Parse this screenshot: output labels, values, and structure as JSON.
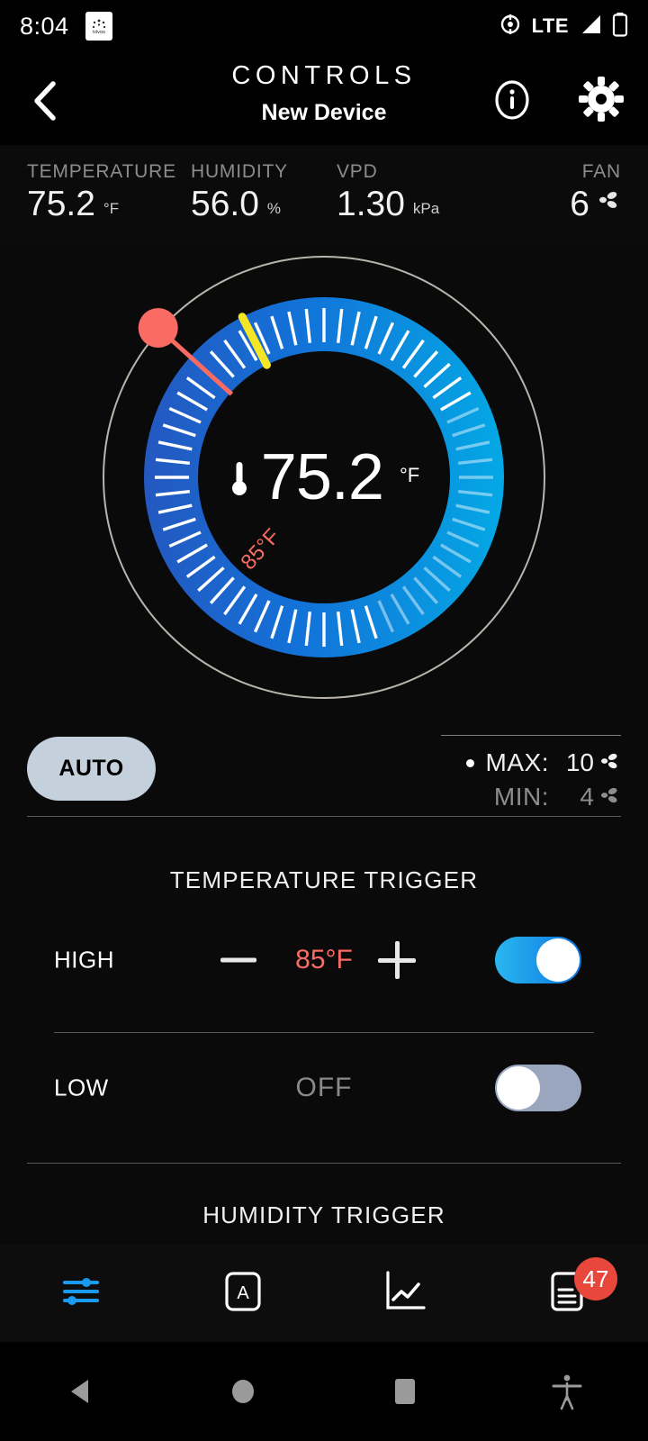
{
  "status_bar": {
    "time": "8:04",
    "app_icon": "app-icon",
    "network": "LTE",
    "icons": [
      "location-icon",
      "signal-icon",
      "battery-icon"
    ]
  },
  "header": {
    "title": "CONTROLS",
    "subtitle": "New Device",
    "back_icon": "chevron-left-icon",
    "info_icon": "info-icon",
    "settings_icon": "gear-icon"
  },
  "stats": [
    {
      "label": "TEMPERATURE",
      "value": "75.2",
      "unit": "°F"
    },
    {
      "label": "HUMIDITY",
      "value": "56.0",
      "unit": "%"
    },
    {
      "label": "VPD",
      "value": "1.30",
      "unit": "kPa"
    },
    {
      "label": "FAN",
      "value": "6",
      "unit": "fan-icon"
    }
  ],
  "gauge": {
    "center_value": "75.2",
    "center_unit": "°F",
    "center_icon": "thermometer-icon",
    "handle_label": "85°F",
    "handle_color": "#fa6b64",
    "needle_color": "#f5e625",
    "ring_start_color": "#2a4fb8",
    "ring_end_color": "#00b7e8",
    "handle_angle_deg": 222,
    "needle_angle_deg": 243,
    "tick_count": 60
  },
  "fan_control": {
    "mode_label": "AUTO",
    "max_label": "MAX:",
    "max_value": "10",
    "min_label": "MIN:",
    "min_value": "4",
    "fan_icon": "fan-icon"
  },
  "temperature_trigger": {
    "title": "TEMPERATURE TRIGGER",
    "rows": [
      {
        "label": "HIGH",
        "value": "85°F",
        "value_color": "#fa6b64",
        "minus_icon": "minus-icon",
        "plus_icon": "plus-icon",
        "toggle_state": "on"
      },
      {
        "label": "LOW",
        "value": "OFF",
        "value_color": "#8a8a8a",
        "toggle_state": "off"
      }
    ]
  },
  "humidity_trigger": {
    "title": "HUMIDITY TRIGGER"
  },
  "tabbar": {
    "items": [
      {
        "icon": "sliders-icon",
        "active": true
      },
      {
        "icon": "auto-box-icon",
        "active": false
      },
      {
        "icon": "line-chart-icon",
        "active": false
      },
      {
        "icon": "document-icon",
        "active": false,
        "badge": "47"
      }
    ],
    "active_color": "#1a9af0",
    "badge_color": "#e8473c"
  },
  "navbar": {
    "back_icon": "android-back-icon",
    "home_icon": "android-home-icon",
    "recents_icon": "android-recents-icon",
    "accessibility_icon": "accessibility-icon"
  }
}
